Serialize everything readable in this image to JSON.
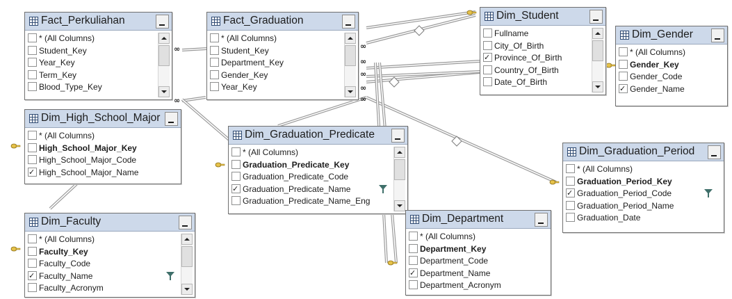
{
  "tables": [
    {
      "id": "fact-perkuliahan",
      "title": "Fact_Perkuliahan",
      "scroll": true,
      "columns": [
        {
          "name": "* (All Columns)",
          "checked": false,
          "key": false,
          "filter": false
        },
        {
          "name": "Student_Key",
          "checked": false,
          "key": false,
          "filter": false
        },
        {
          "name": "Year_Key",
          "checked": false,
          "key": false,
          "filter": false
        },
        {
          "name": "Term_Key",
          "checked": false,
          "key": false,
          "filter": false
        },
        {
          "name": "Blood_Type_Key",
          "checked": false,
          "key": false,
          "filter": false
        }
      ]
    },
    {
      "id": "fact-graduation",
      "title": "Fact_Graduation",
      "scroll": true,
      "columns": [
        {
          "name": "* (All Columns)",
          "checked": false,
          "key": false,
          "filter": false
        },
        {
          "name": "Student_Key",
          "checked": false,
          "key": false,
          "filter": false
        },
        {
          "name": "Department_Key",
          "checked": false,
          "key": false,
          "filter": false
        },
        {
          "name": "Gender_Key",
          "checked": false,
          "key": false,
          "filter": false
        },
        {
          "name": "Year_Key",
          "checked": false,
          "key": false,
          "filter": false
        }
      ]
    },
    {
      "id": "dim-student",
      "title": "Dim_Student",
      "scroll": true,
      "columns": [
        {
          "name": "Fullname",
          "checked": false,
          "key": false,
          "filter": false
        },
        {
          "name": "City_Of_Birth",
          "checked": false,
          "key": false,
          "filter": false
        },
        {
          "name": "Province_Of_Birth",
          "checked": true,
          "key": false,
          "filter": false
        },
        {
          "name": "Country_Of_Birth",
          "checked": false,
          "key": false,
          "filter": false
        },
        {
          "name": "Date_Of_Birth",
          "checked": false,
          "key": false,
          "filter": false
        }
      ]
    },
    {
      "id": "dim-gender",
      "title": "Dim_Gender",
      "scroll": false,
      "columns": [
        {
          "name": "* (All Columns)",
          "checked": false,
          "key": false,
          "filter": false
        },
        {
          "name": "Gender_Key",
          "checked": false,
          "key": true,
          "filter": false
        },
        {
          "name": "Gender_Code",
          "checked": false,
          "key": false,
          "filter": false
        },
        {
          "name": "Gender_Name",
          "checked": true,
          "key": false,
          "filter": false
        }
      ]
    },
    {
      "id": "dim-high-school-major",
      "title": "Dim_High_School_Major",
      "scroll": false,
      "columns": [
        {
          "name": "* (All Columns)",
          "checked": false,
          "key": false,
          "filter": false
        },
        {
          "name": "High_School_Major_Key",
          "checked": false,
          "key": true,
          "filter": false
        },
        {
          "name": "High_School_Major_Code",
          "checked": false,
          "key": false,
          "filter": false
        },
        {
          "name": "High_School_Major_Name",
          "checked": true,
          "key": false,
          "filter": false
        }
      ]
    },
    {
      "id": "dim-graduation-predicate",
      "title": "Dim_Graduation_Predicate",
      "scroll": true,
      "columns": [
        {
          "name": "* (All Columns)",
          "checked": false,
          "key": false,
          "filter": false
        },
        {
          "name": "Graduation_Predicate_Key",
          "checked": false,
          "key": true,
          "filter": false
        },
        {
          "name": "Graduation_Predicate_Code",
          "checked": false,
          "key": false,
          "filter": false
        },
        {
          "name": "Graduation_Predicate_Name",
          "checked": true,
          "key": false,
          "filter": true
        },
        {
          "name": "Graduation_Predicate_Name_Eng",
          "checked": false,
          "key": false,
          "filter": false
        }
      ]
    },
    {
      "id": "dim-graduation-period",
      "title": "Dim_Graduation_Period",
      "scroll": false,
      "columns": [
        {
          "name": "* (All Columns)",
          "checked": false,
          "key": false,
          "filter": false
        },
        {
          "name": "Graduation_Period_Key",
          "checked": false,
          "key": true,
          "filter": false
        },
        {
          "name": "Graduation_Period_Code",
          "checked": true,
          "key": false,
          "filter": true
        },
        {
          "name": "Graduation_Period_Name",
          "checked": false,
          "key": false,
          "filter": false
        },
        {
          "name": "Graduation_Date",
          "checked": false,
          "key": false,
          "filter": false
        }
      ]
    },
    {
      "id": "dim-faculty",
      "title": "Dim_Faculty",
      "scroll": true,
      "columns": [
        {
          "name": "* (All Columns)",
          "checked": false,
          "key": false,
          "filter": false
        },
        {
          "name": "Faculty_Key",
          "checked": false,
          "key": true,
          "filter": false
        },
        {
          "name": "Faculty_Code",
          "checked": false,
          "key": false,
          "filter": false
        },
        {
          "name": "Faculty_Name",
          "checked": true,
          "key": false,
          "filter": true
        },
        {
          "name": "Faculty_Acronym",
          "checked": false,
          "key": false,
          "filter": false
        }
      ]
    },
    {
      "id": "dim-department",
      "title": "Dim_Department",
      "scroll": false,
      "columns": [
        {
          "name": "* (All Columns)",
          "checked": false,
          "key": false,
          "filter": false
        },
        {
          "name": "Department_Key",
          "checked": false,
          "key": true,
          "filter": false
        },
        {
          "name": "Department_Code",
          "checked": false,
          "key": false,
          "filter": false
        },
        {
          "name": "Department_Name",
          "checked": true,
          "key": false,
          "filter": false
        },
        {
          "name": "Department_Acronym",
          "checked": false,
          "key": false,
          "filter": false
        }
      ]
    }
  ],
  "colors": {
    "header": "#cdd9ea",
    "border": "#6f6f6f",
    "link": "#9a9a9a",
    "key_icon": "#e6c24a",
    "filter_icon": "#3f6f6a"
  }
}
